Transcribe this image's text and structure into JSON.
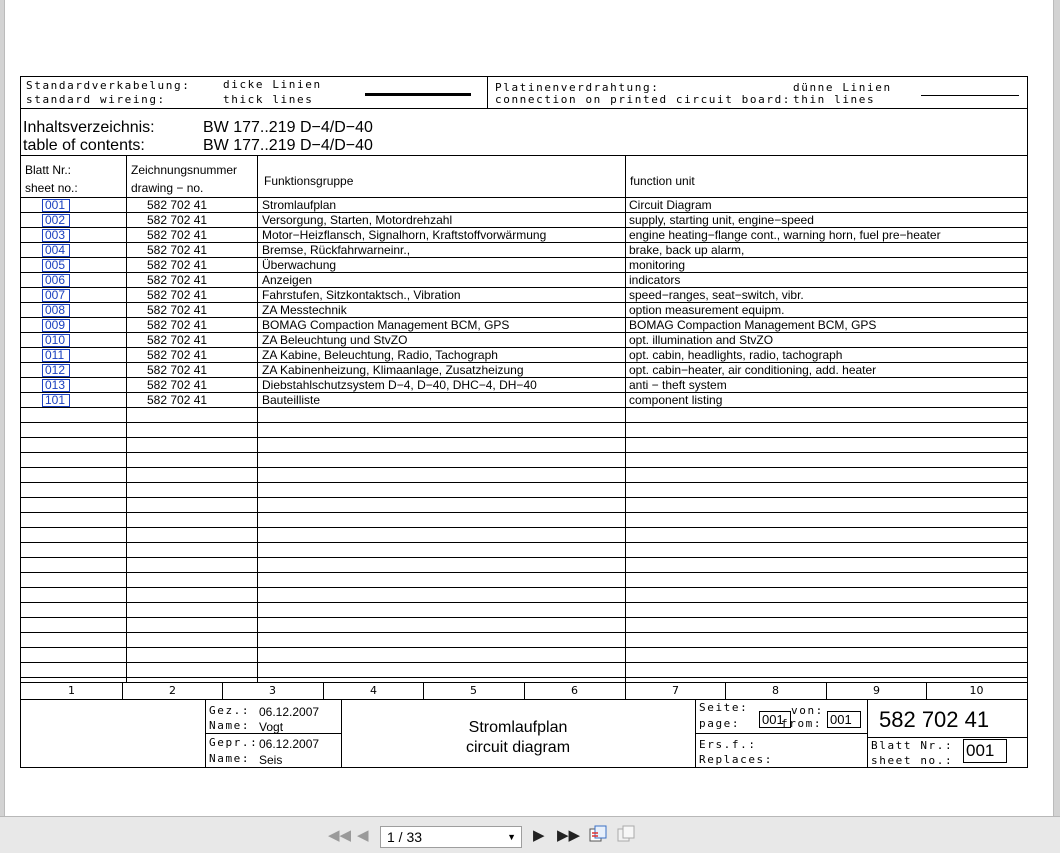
{
  "legend": {
    "std_de": "Standardverkabelung:",
    "std_en": "standard wireing:",
    "thick_de": "dicke Linien",
    "thick_en": "thick lines",
    "pcb_de": "Platinenverdrahtung:",
    "pcb_en": "connection on printed circuit board:",
    "thin_de": "dünne Linien",
    "thin_en": "thin lines"
  },
  "header": {
    "toc_de": "Inhaltsverzeichnis:",
    "toc_en": "table of contents:",
    "model_de": "BW 177..219 D−4/D−40",
    "model_en": "BW 177..219 D−4/D−40"
  },
  "columns": {
    "sheet_de": "Blatt Nr.:",
    "sheet_en": "sheet no.:",
    "drawing_de": "Zeichnungsnummer",
    "drawing_en": "drawing − no.",
    "group": "Funktionsgruppe",
    "unit": "function unit"
  },
  "rows": [
    {
      "sheet": "001",
      "drawing": "582 702 41",
      "group": "Stromlaufplan",
      "unit": "Circuit Diagram"
    },
    {
      "sheet": "002",
      "drawing": "582 702 41",
      "group": "Versorgung, Starten, Motordrehzahl",
      "unit": "supply, starting unit, engine−speed"
    },
    {
      "sheet": "003",
      "drawing": "582 702 41",
      "group": "Motor−Heizflansch, Signalhorn, Kraftstoffvorwärmung",
      "unit": "engine heating−flange cont., warning horn, fuel pre−heater"
    },
    {
      "sheet": "004",
      "drawing": "582 702 41",
      "group": "Bremse, Rückfahrwarneinr.,",
      "unit": "brake, back up alarm,"
    },
    {
      "sheet": "005",
      "drawing": "582 702 41",
      "group": "Überwachung",
      "unit": "monitoring"
    },
    {
      "sheet": "006",
      "drawing": "582 702 41",
      "group": "Anzeigen",
      "unit": "indicators"
    },
    {
      "sheet": "007",
      "drawing": "582 702 41",
      "group": "Fahrstufen, Sitzkontaktsch., Vibration",
      "unit": "speed−ranges, seat−switch, vibr."
    },
    {
      "sheet": "008",
      "drawing": "582 702 41",
      "group": "ZA Messtechnik",
      "unit": "option measurement equipm."
    },
    {
      "sheet": "009",
      "drawing": "582 702 41",
      "group": "BOMAG Compaction Management BCM, GPS",
      "unit": "BOMAG Compaction Management BCM, GPS"
    },
    {
      "sheet": "010",
      "drawing": "582 702 41",
      "group": "ZA Beleuchtung und StvZO",
      "unit": "opt. illumination and StvZO"
    },
    {
      "sheet": "011",
      "drawing": "582 702 41",
      "group": "ZA Kabine, Beleuchtung, Radio, Tachograph",
      "unit": "opt. cabin, headlights, radio, tachograph"
    },
    {
      "sheet": "012",
      "drawing": "582 702 41",
      "group": "ZA Kabinenheizung, Klimaanlage, Zusatzheizung",
      "unit": "opt. cabin−heater, air conditioning, add. heater"
    },
    {
      "sheet": "013",
      "drawing": "582 702 41",
      "group": "Diebstahlschutzsystem D−4, D−40, DHC−4, DH−40",
      "unit": "anti − theft system"
    },
    {
      "sheet": "101",
      "drawing": "582 702 41",
      "group": "Bauteilliste",
      "unit": "component listing"
    }
  ],
  "column_numbers": [
    "1",
    "2",
    "3",
    "4",
    "5",
    "6",
    "7",
    "8",
    "9",
    "10"
  ],
  "title_block": {
    "drawn_label": "Gez.:",
    "drawn_date": "06.12.2007",
    "name_label": "Name:",
    "drawn_name": "Vogt",
    "checked_label": "Gepr.:",
    "checked_date": "06.12.2007",
    "name_label2": "Name:",
    "checked_name": "Seis",
    "title_de": "Stromlaufplan",
    "title_en": "circuit diagram",
    "page_de": "Seite:",
    "page_en": "page:",
    "page_value": "001",
    "of_de": "von:",
    "of_en": "from:",
    "of_value": "001",
    "drawing_number": "582 702 41",
    "replaces_de": "Ers.f.:",
    "replaces_en": "Replaces:",
    "sheet_de": "Blatt Nr.:",
    "sheet_en": "sheet no.:",
    "sheet_value": "001"
  },
  "viewer": {
    "page_indicator": "1 / 33"
  }
}
